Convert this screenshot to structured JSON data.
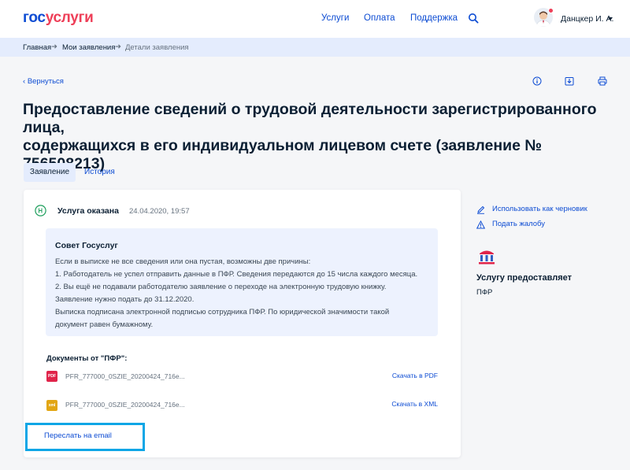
{
  "header": {
    "logo_part1": "гос",
    "logo_part2": "услуги",
    "nav": [
      "Услуги",
      "Оплата",
      "Поддержка"
    ],
    "user_name": "Данцкер И. А."
  },
  "breadcrumbs": [
    "Главная",
    "Мои заявления",
    "Детали заявления"
  ],
  "back_label": "Вернуться",
  "page_title_line1": "Предоставление сведений о трудовой деятельности зарегистрированного лица,",
  "page_title_line2": "содержащихся в его индивидуальном лицевом счете (заявление № 756508213)",
  "tabs": [
    "Заявление",
    "История"
  ],
  "status": {
    "label": "Услуга оказана",
    "time": "24.04.2020, 19:57"
  },
  "advice": {
    "title": "Совет Госуслуг",
    "lines": [
      "Если в выписке не все сведения или она пустая, возможны две причины:",
      "1. Работодатель не успел отправить данные в ПФР. Сведения передаются до 15 числа каждого месяца.",
      "2. Вы ещё не подавали работодателю заявление о переходе на электронную трудовую книжку.",
      "Заявление нужно подать до 31.12.2020.",
      "Выписка подписана электронной подписью сотрудника ПФР. По юридической значимости такой",
      "документ равен бумажному."
    ]
  },
  "documents": {
    "title": "Документы от \"ПФР\":",
    "items": [
      {
        "type": "PDF",
        "name": "PFR_777000_0SZIE_20200424_716e...",
        "link": "Скачать в PDF"
      },
      {
        "type": "xml",
        "name": "PFR_777000_0SZIE_20200424_716e...",
        "link": "Скачать в XML"
      }
    ]
  },
  "email_button": "Переслать на email",
  "side": {
    "draft_link": "Использовать как черновик",
    "complaint_link": "Подать жалобу",
    "provider_title": "Услугу предоставляет",
    "provider_name": "ПФР"
  },
  "colors": {
    "brand_blue": "#0d4cd3",
    "brand_red": "#ee3f58",
    "highlight": "#0da6e6",
    "status_green": "#1c9e5b"
  }
}
